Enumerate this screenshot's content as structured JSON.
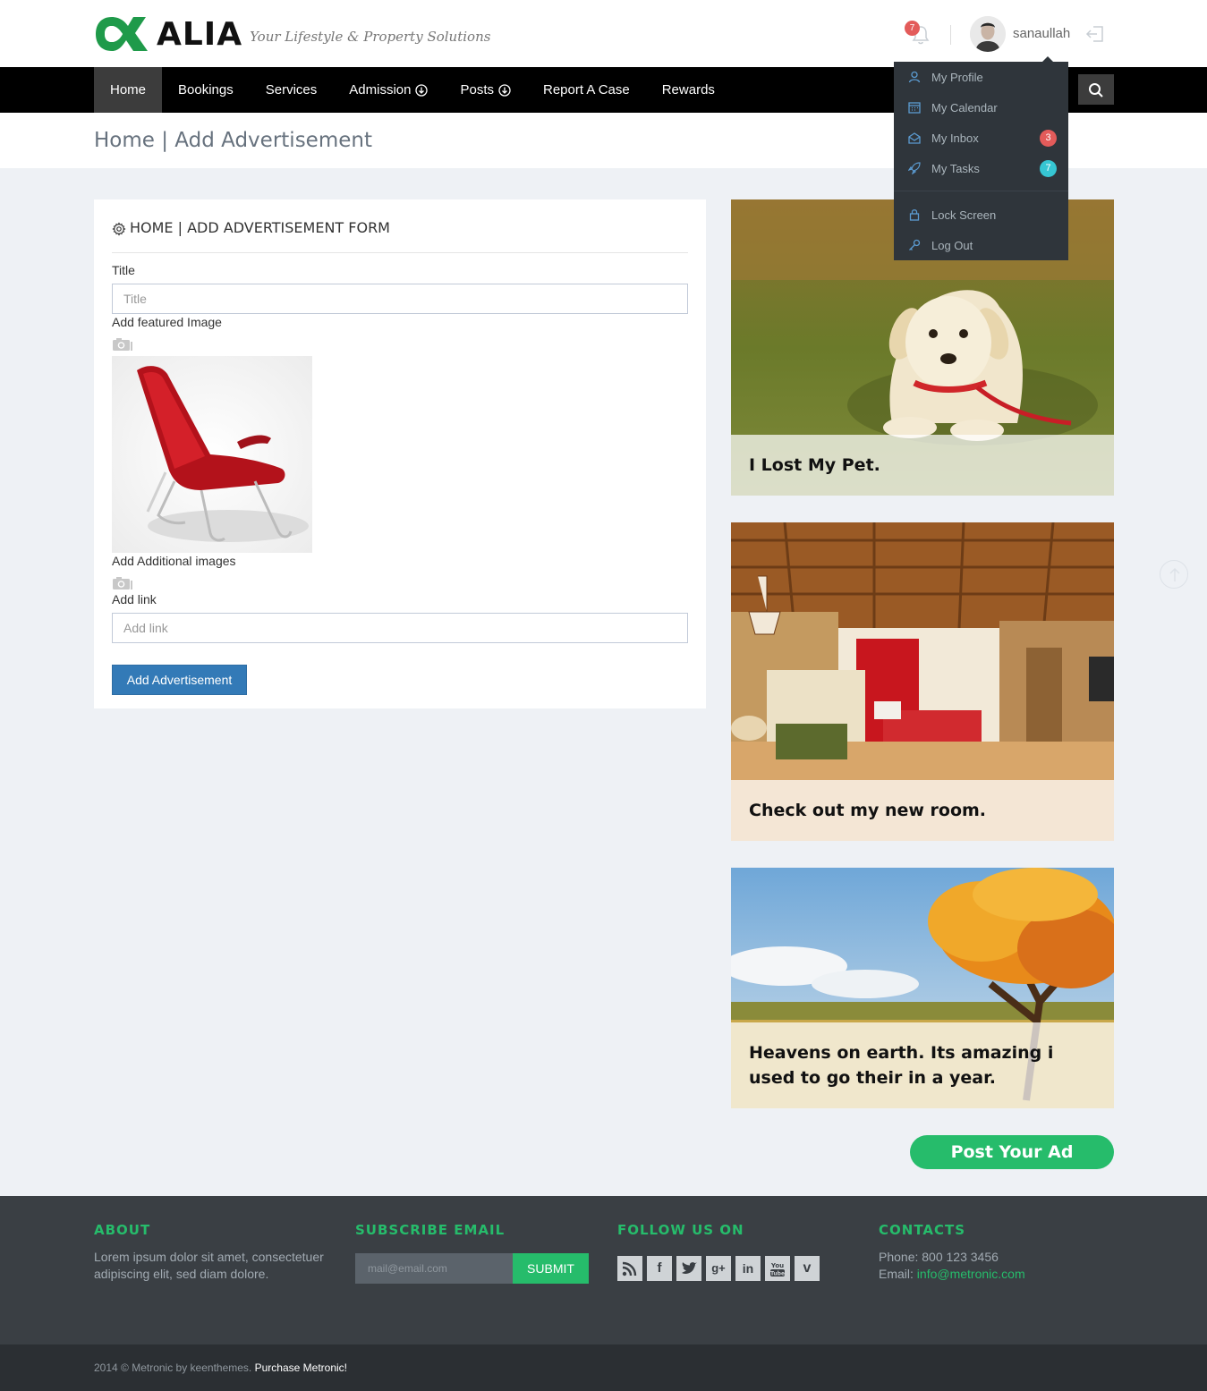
{
  "header": {
    "brand": "ALIA",
    "tagline": "Your Lifestyle & Property Solutions",
    "notification_count": "7",
    "username": "sanaullah"
  },
  "nav": {
    "items": [
      {
        "label": "Home"
      },
      {
        "label": "Bookings"
      },
      {
        "label": "Services"
      },
      {
        "label": "Admission"
      },
      {
        "label": "Posts"
      },
      {
        "label": "Report A Case"
      },
      {
        "label": "Rewards"
      }
    ]
  },
  "breadcrumb": "Home | Add Advertisement",
  "form": {
    "title": "HOME | ADD ADVERTISEMENT FORM",
    "title_label": "Title",
    "title_placeholder": "Title",
    "featured_label": "Add featured Image",
    "additional_label": "Add Additional images",
    "link_label": "Add link",
    "link_placeholder": "Add link",
    "submit_label": "Add Advertisement"
  },
  "user_menu": {
    "items": [
      {
        "label": "My Profile",
        "icon": "user-icon"
      },
      {
        "label": "My Calendar",
        "icon": "calendar-icon"
      },
      {
        "label": "My Inbox",
        "icon": "envelope-icon",
        "badge": "3"
      },
      {
        "label": "My Tasks",
        "icon": "rocket-icon",
        "badge": "7"
      },
      {
        "label": "Lock Screen",
        "icon": "lock-icon"
      },
      {
        "label": "Log Out",
        "icon": "key-icon"
      }
    ]
  },
  "ads": [
    {
      "caption": "I Lost My Pet."
    },
    {
      "caption": "Check out my new room."
    },
    {
      "caption": "Heavens on earth. Its amazing i used to go their in a year."
    }
  ],
  "post_ad_label": "Post Your Ad",
  "footer": {
    "about_title": "ABOUT",
    "about_text": "Lorem ipsum dolor sit amet, consectetuer adipiscing elit, sed diam dolore.",
    "subscribe_title": "SUBSCRIBE EMAIL",
    "email_placeholder": "mail@email.com",
    "submit_label": "SUBMIT",
    "follow_title": "FOLLOW US ON",
    "social": [
      "rss-icon",
      "facebook-icon",
      "twitter-icon",
      "google-plus-icon",
      "linkedin-icon",
      "youtube-icon",
      "vimeo-icon"
    ],
    "contacts_title": "CONTACTS",
    "phone": "Phone: 800 123 3456",
    "email_label": "Email: ",
    "email": "info@metronic.com",
    "copyright": "2014 © Metronic by keenthemes.",
    "purchase": "Purchase Metronic!"
  },
  "colors": {
    "accent_green": "#26bc6b",
    "primary_blue": "#337ab7",
    "badge_red": "#e35b5a",
    "badge_cyan": "#36c6d3"
  }
}
